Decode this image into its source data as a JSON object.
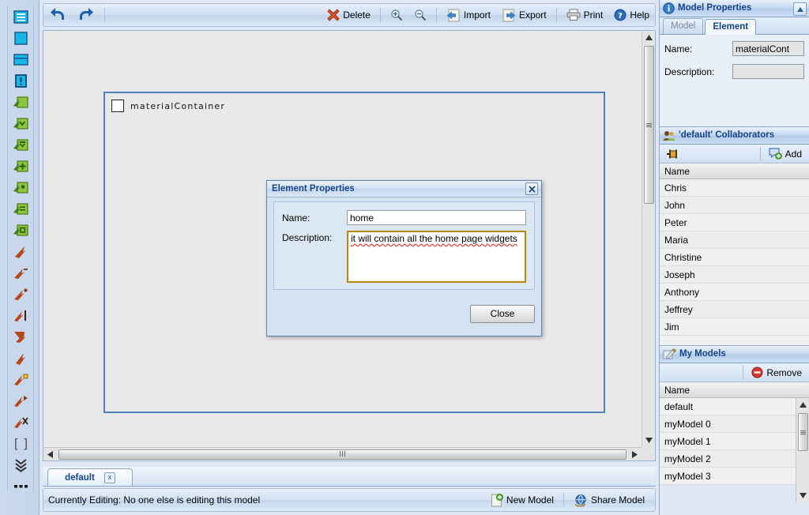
{
  "toolbar": {
    "undo_label": "Undo",
    "redo_label": "Redo",
    "delete_label": "Delete",
    "zoom_in_label": "Zoom In",
    "zoom_out_label": "Zoom Out",
    "import_label": "Import",
    "export_label": "Export",
    "print_label": "Print",
    "help_label": "Help"
  },
  "palette": {
    "tools": [
      {
        "name": "list-element-tool",
        "label": "List Element"
      },
      {
        "name": "box-element-tool",
        "label": "Box Element"
      },
      {
        "name": "titled-box-tool",
        "label": "Titled Box"
      },
      {
        "name": "note-element-tool",
        "label": "Note Element"
      },
      {
        "name": "green-plain-tool",
        "label": "Element"
      },
      {
        "name": "green-check-tool",
        "label": "Element Check"
      },
      {
        "name": "green-cut-tool",
        "label": "Element Cut"
      },
      {
        "name": "green-add-tool",
        "label": "Element Add"
      },
      {
        "name": "green-dot-tool",
        "label": "Element Dot"
      },
      {
        "name": "green-lines-tool",
        "label": "Element Lines"
      },
      {
        "name": "green-square-tool",
        "label": "Element Square"
      },
      {
        "name": "arrow-plain-tool",
        "label": "Relation"
      },
      {
        "name": "arrow-minus-tool",
        "label": "Relation Minus"
      },
      {
        "name": "arrow-dot-tool",
        "label": "Relation Dot"
      },
      {
        "name": "arrow-bar-tool",
        "label": "Relation Bar"
      },
      {
        "name": "arrow-double-tool",
        "label": "Relation Double"
      },
      {
        "name": "arrow-up-tool",
        "label": "Relation Up"
      },
      {
        "name": "arrow-square-tool",
        "label": "Relation Square"
      },
      {
        "name": "arrow-filled-tool",
        "label": "Relation Filled"
      },
      {
        "name": "arrow-x-tool",
        "label": "Relation Delete"
      },
      {
        "name": "brackets-tool",
        "label": "Brackets"
      },
      {
        "name": "chevrons-tool",
        "label": "Chevrons"
      },
      {
        "name": "dots-tool",
        "label": "More"
      }
    ]
  },
  "canvas": {
    "shape_label": "materialContainer"
  },
  "dialog": {
    "title": "Element Properties",
    "close_icon_label": "Close dialog",
    "name_label": "Name:",
    "name_value": "home",
    "description_label": "Description:",
    "description_value": "it will contain all the home page widgets",
    "close_button": "Close"
  },
  "tabstrip": {
    "tabs": [
      {
        "label": "default",
        "close": "x"
      }
    ]
  },
  "status": {
    "text": "Currently Editing: No one else is editing this model",
    "new_model": "New Model",
    "share_model": "Share Model"
  },
  "model_properties": {
    "title": "Model Properties",
    "tabs": [
      {
        "label": "Model",
        "active": false
      },
      {
        "label": "Element",
        "active": true
      }
    ],
    "name_label": "Name:",
    "name_value": "materialCont",
    "description_label": "Description:",
    "description_value": ""
  },
  "collaborators": {
    "title": "'default' Collaborators",
    "pin_label": "Pin",
    "add_label": "Add",
    "column": "Name",
    "rows": [
      "Chris",
      "John",
      "Peter",
      "Maria",
      "Christine",
      "Joseph",
      "Anthony",
      "Jeffrey",
      "Jim"
    ]
  },
  "my_models": {
    "title": "My Models",
    "remove_label": "Remove",
    "column": "Name",
    "rows": [
      "default",
      "myModel 0",
      "myModel 1",
      "myModel 2",
      "myModel 3"
    ]
  },
  "colors": {
    "accent": "#15428b",
    "shape_border": "#4f81bd",
    "panel": "#dfe7f2",
    "delete_red": "#c8491d",
    "green_tool": "#8cc63f",
    "orange_arrow": "#b5481b",
    "dialog_field_focus": "#b8860b"
  }
}
